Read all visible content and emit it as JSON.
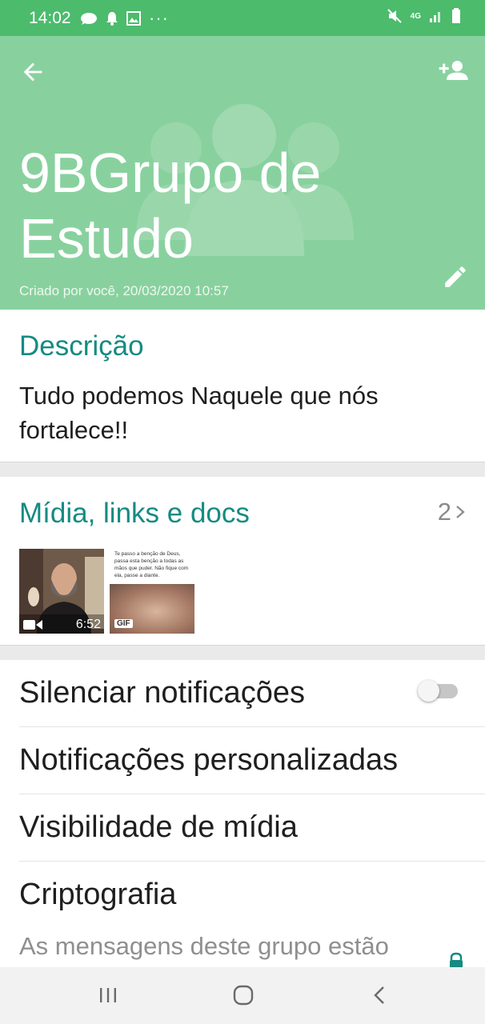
{
  "status_bar": {
    "time": "14:02",
    "dots": "···",
    "network": "4G"
  },
  "header": {
    "group_name": "9BGrupo de Estudo",
    "created": "Criado por você, 20/03/2020 10:57",
    "background_color": "#88d19e"
  },
  "description": {
    "heading": "Descrição",
    "text": "Tudo podemos Naquele que nós fortalece!!"
  },
  "media": {
    "heading": "Mídia, links e docs",
    "count": "2",
    "items": [
      {
        "type": "video",
        "duration": "6:52"
      },
      {
        "type": "gif",
        "badge": "GIF",
        "caption": "Te passo a benção de Deus, passa esta benção a todas as mãos que puder. Não fique com ela, passe a diante."
      }
    ]
  },
  "settings": {
    "mute_label": "Silenciar notificações",
    "mute_on": false,
    "custom_notifications_label": "Notificações personalizadas",
    "media_visibility_label": "Visibilidade de mídia",
    "encryption_label": "Criptografia",
    "encryption_sub": "As mensagens deste grupo estão protegidas com a"
  },
  "accent_color": "#158b82",
  "icons": [
    "back-arrow-icon",
    "add-participant-icon",
    "edit-icon",
    "group-avatar-icon",
    "chevron-right-icon",
    "video-icon",
    "lock-icon",
    "recent-apps-icon",
    "home-icon",
    "back-icon"
  ]
}
